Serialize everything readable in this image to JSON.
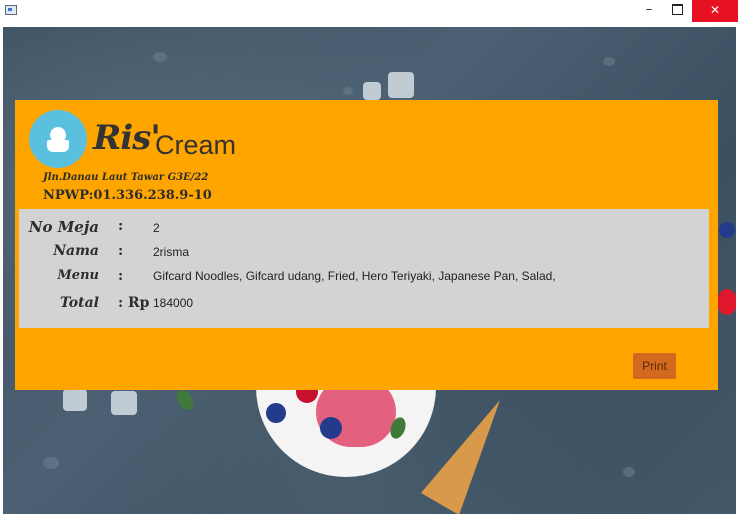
{
  "window": {
    "minimize_glyph": "–",
    "close_glyph": "✕",
    "icon": "app-window-icon"
  },
  "brand": {
    "logo_icon": "ice-cream-cup-icon",
    "name_part1": "Ris'",
    "name_part2": "Cream",
    "address": "Jln.Danau Laut Tawar G3E/22",
    "npwp": "NPWP:01.336.238.9-10"
  },
  "details": {
    "no_meja_label": "No Meja",
    "no_meja_colon": ":",
    "no_meja_value": "2",
    "nama_label": "Nama",
    "nama_colon": ":",
    "nama_value": "2risma",
    "menu_label": "Menu",
    "menu_colon": ":",
    "menu_value": "Gifcard Noodles, Gifcard udang, Fried, Hero Teriyaki, Japanese Pan, Salad,",
    "total_label": "Total",
    "total_colon": ": Rp",
    "total_value": "184000"
  },
  "actions": {
    "print_label": "Print"
  },
  "colors": {
    "panel": "#ffa500",
    "details_bg": "#d3d3d3",
    "print_button": "#d2691e",
    "logo_circle": "#5bc0de"
  }
}
